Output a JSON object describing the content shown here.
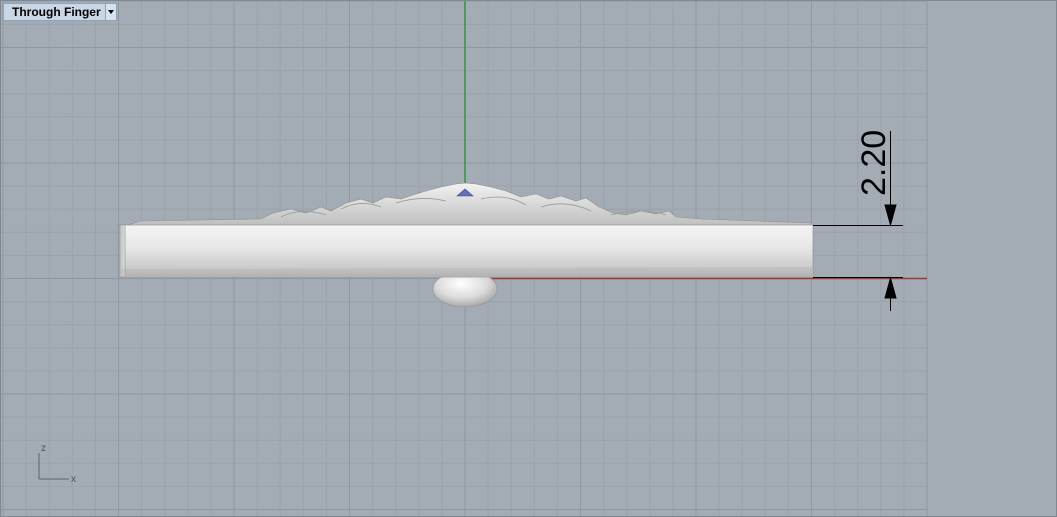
{
  "viewport": {
    "title": "Through Finger"
  },
  "dimension": {
    "label": "2.20"
  },
  "axis_gizmo": {
    "z_label": "z",
    "x_label": "x"
  },
  "colors": {
    "background": "#a3abb4",
    "grid_minor": "#9aa2ab",
    "grid_major": "#8f979f",
    "y_axis": "#2e9a3a",
    "x_axis": "#9b3b36",
    "title_bg": "#c9d6e6"
  },
  "icons": {
    "menu": "chevron-down-icon"
  }
}
